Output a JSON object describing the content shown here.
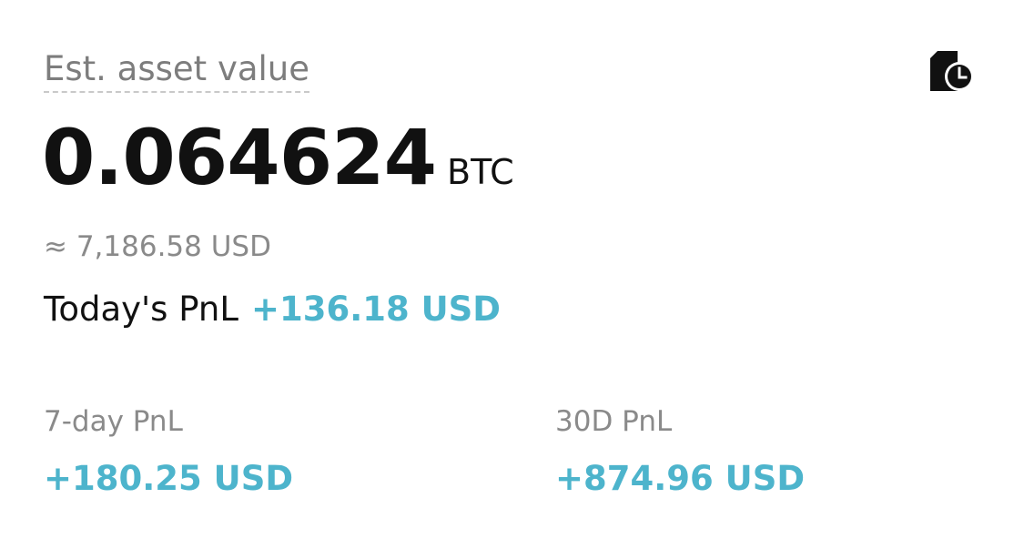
{
  "asset": {
    "label": "Est. asset value",
    "balance": "0.064624",
    "unit": "BTC",
    "approx_usd": "≈ 7,186.58 USD"
  },
  "today": {
    "label": "Today's PnL",
    "value": "+136.18 USD"
  },
  "pnl": [
    {
      "label": "7-day PnL",
      "value": "+180.25 USD"
    },
    {
      "label": "30D PnL",
      "value": "+874.96 USD"
    }
  ],
  "icons": {
    "history": "history-clock-icon"
  },
  "colors": {
    "positive": "#4db4cc",
    "primary_text": "#111111",
    "secondary_text": "#8a8a8a"
  }
}
